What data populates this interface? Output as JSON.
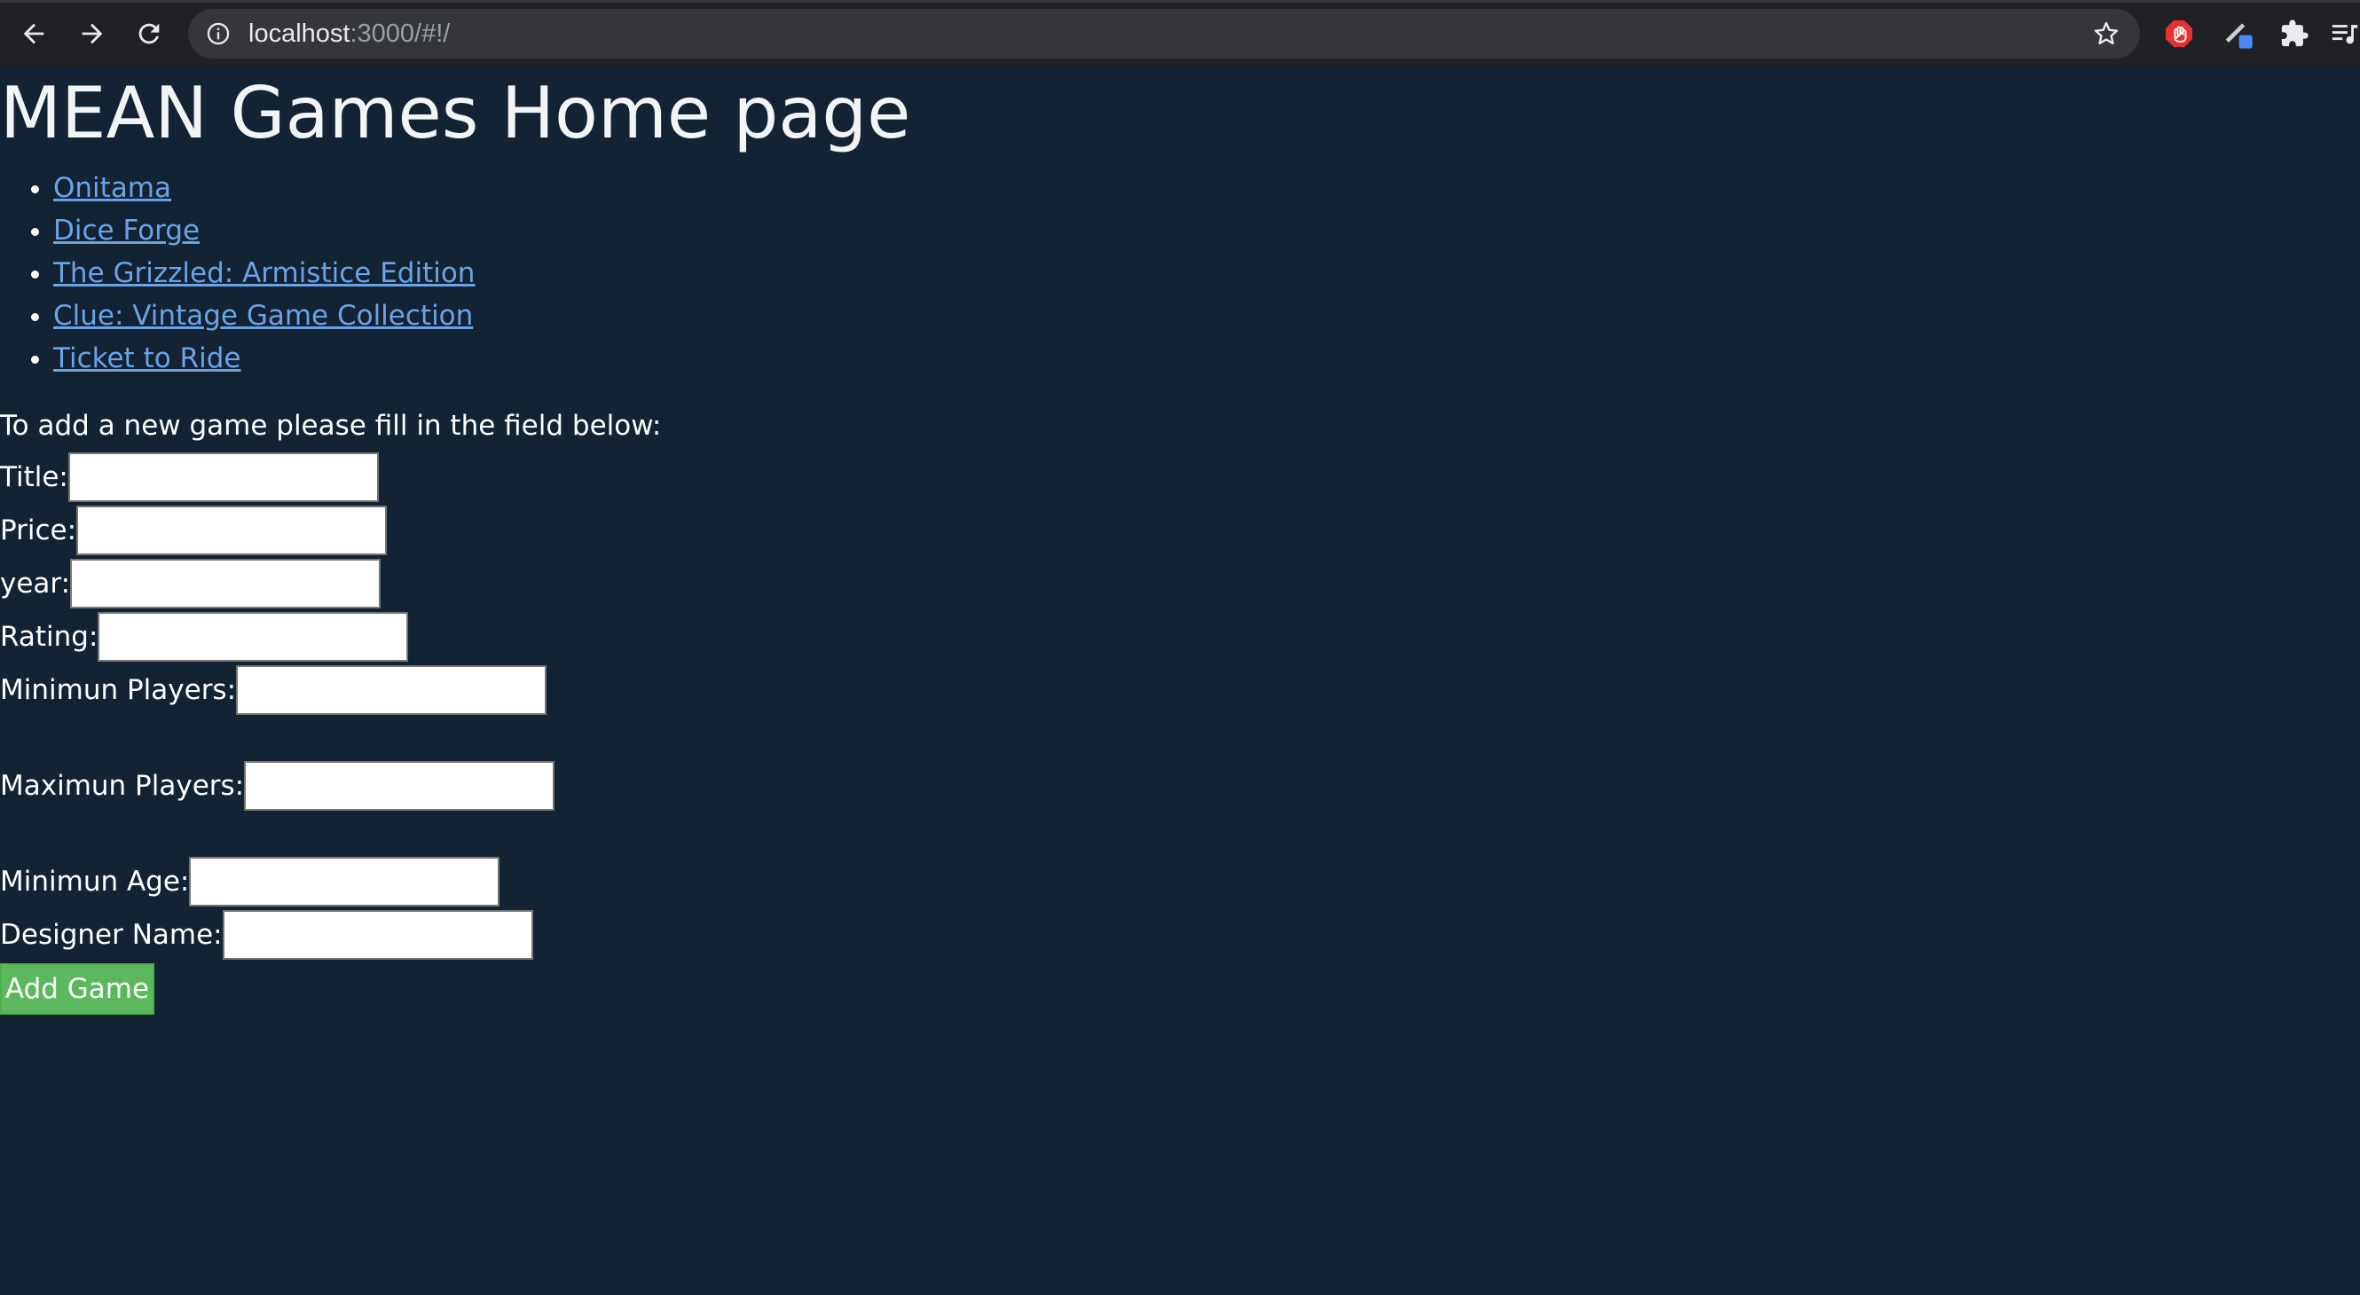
{
  "browser": {
    "url_host": "localhost",
    "url_path": ":3000/#!/"
  },
  "page": {
    "title": "MEAN Games Home page"
  },
  "games": [
    {
      "title": "Onitama"
    },
    {
      "title": "Dice Forge"
    },
    {
      "title": "The Grizzled: Armistice Edition"
    },
    {
      "title": "Clue: Vintage Game Collection"
    },
    {
      "title": "Ticket to Ride"
    }
  ],
  "form": {
    "intro": "To add a new game please fill in the field below:",
    "fields": {
      "title": {
        "label": "Title:",
        "value": ""
      },
      "price": {
        "label": "Price:",
        "value": ""
      },
      "year": {
        "label": "year:",
        "value": ""
      },
      "rating": {
        "label": "Rating:",
        "value": ""
      },
      "min_players": {
        "label": "Minimun Players:",
        "value": ""
      },
      "max_players": {
        "label": "Maximun Players:",
        "value": ""
      },
      "min_age": {
        "label": "Minimun Age:",
        "value": ""
      },
      "designer": {
        "label": "Designer Name:",
        "value": ""
      }
    },
    "submit_label": "Add Game"
  },
  "colors": {
    "page_background": "#132334",
    "link": "#6aa3e8",
    "submit_button": "#5cb85c"
  },
  "icons": [
    "back-arrow-icon",
    "forward-arrow-icon",
    "reload-icon",
    "info-icon",
    "star-icon",
    "adblock-icon",
    "pen-extension-icon",
    "puzzle-icon",
    "media-list-icon"
  ]
}
